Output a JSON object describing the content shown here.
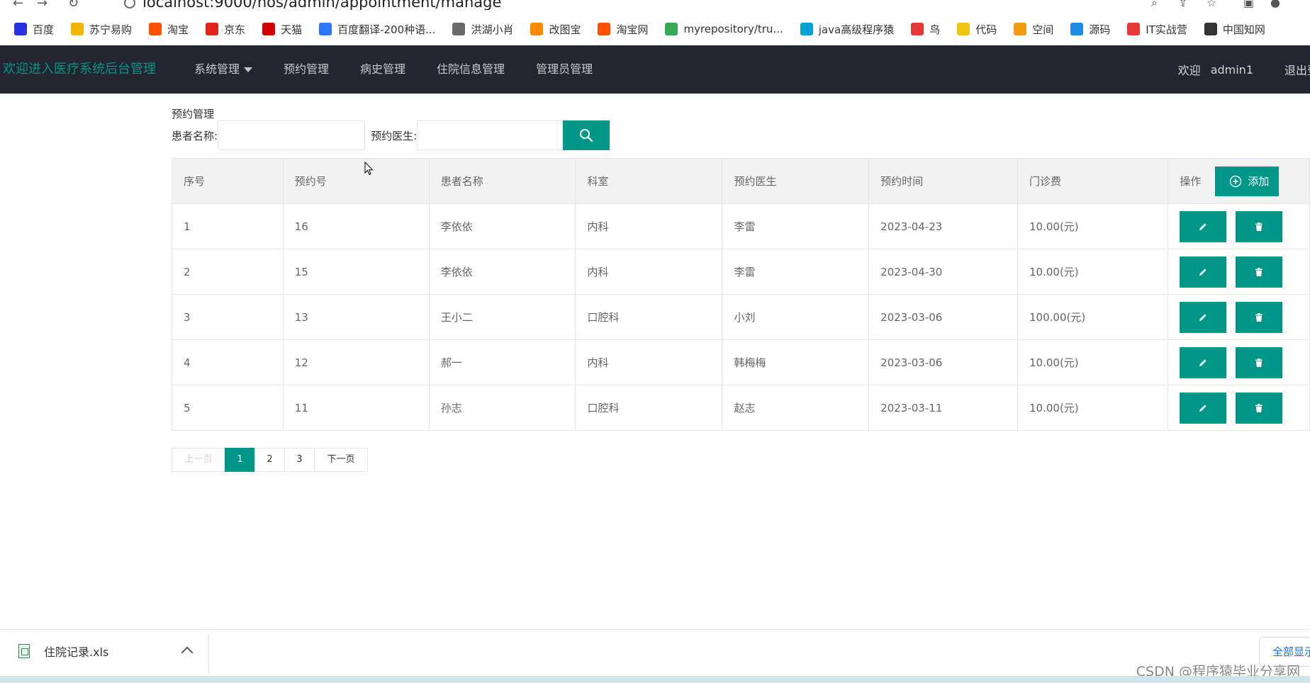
{
  "browser": {
    "url": "localhost:9000/hos/admin/appointment/manage",
    "bookmarks": [
      {
        "label": "百度",
        "color": "#2932e1"
      },
      {
        "label": "苏宁易购",
        "color": "#f5b400"
      },
      {
        "label": "淘宝",
        "color": "#ff5000"
      },
      {
        "label": "京东",
        "color": "#e1251b"
      },
      {
        "label": "天猫",
        "color": "#d00000"
      },
      {
        "label": "百度翻译-200种语...",
        "color": "#2d76f8"
      },
      {
        "label": "洪湖小肖",
        "color": "#6a6a6a"
      },
      {
        "label": "改图宝",
        "color": "#ff8a00"
      },
      {
        "label": "淘宝网",
        "color": "#ff5000"
      },
      {
        "label": "myrepository/tru...",
        "color": "#34a853"
      },
      {
        "label": "java高级程序猿",
        "color": "#00a1d6"
      },
      {
        "label": "鸟",
        "color": "#e53935"
      },
      {
        "label": "代码",
        "color": "#f1c40f"
      },
      {
        "label": "空间",
        "color": "#f39c12"
      },
      {
        "label": "源码",
        "color": "#1e88e5"
      },
      {
        "label": "IT实战营",
        "color": "#e53935"
      },
      {
        "label": "中国知网",
        "color": "#333333"
      }
    ]
  },
  "header": {
    "brand": "欢迎进入医疗系统后台管理",
    "nav": [
      "系统管理",
      "预约管理",
      "病史管理",
      "住院信息管理",
      "管理员管理"
    ],
    "greeting": "欢迎",
    "username": "admin1",
    "logout": "退出登录"
  },
  "page": {
    "title": "预约管理",
    "search": {
      "patient_label": "患者名称:",
      "patient_value": "",
      "doctor_label": "预约医生:",
      "doctor_value": ""
    }
  },
  "table": {
    "columns": [
      "序号",
      "预约号",
      "患者名称",
      "科室",
      "预约医生",
      "预约时间",
      "门诊费",
      "操作"
    ],
    "add_label": "添加",
    "rows": [
      {
        "index": "1",
        "appt_no": "16",
        "patient": "李依依",
        "dept": "内科",
        "doctor": "李雷",
        "date": "2023-04-23",
        "fee": "10.00(元)"
      },
      {
        "index": "2",
        "appt_no": "15",
        "patient": "李依依",
        "dept": "内科",
        "doctor": "李雷",
        "date": "2023-04-30",
        "fee": "10.00(元)"
      },
      {
        "index": "3",
        "appt_no": "13",
        "patient": "王小二",
        "dept": "口腔科",
        "doctor": "小刘",
        "date": "2023-03-06",
        "fee": "100.00(元)"
      },
      {
        "index": "4",
        "appt_no": "12",
        "patient": "郝一",
        "dept": "内科",
        "doctor": "韩梅梅",
        "date": "2023-03-06",
        "fee": "10.00(元)"
      },
      {
        "index": "5",
        "appt_no": "11",
        "patient": "孙志",
        "dept": "口腔科",
        "doctor": "赵志",
        "date": "2023-03-11",
        "fee": "10.00(元)"
      }
    ]
  },
  "pager": {
    "prev": "上一页",
    "pages": [
      "1",
      "2",
      "3"
    ],
    "current": "1",
    "next": "下一页"
  },
  "downloads": {
    "file": "住院记录.xls",
    "show_all": "全部显示"
  },
  "watermark": "CSDN @程序猿毕业分享网",
  "colors": {
    "accent": "#009688",
    "header_bg": "#23262e"
  }
}
